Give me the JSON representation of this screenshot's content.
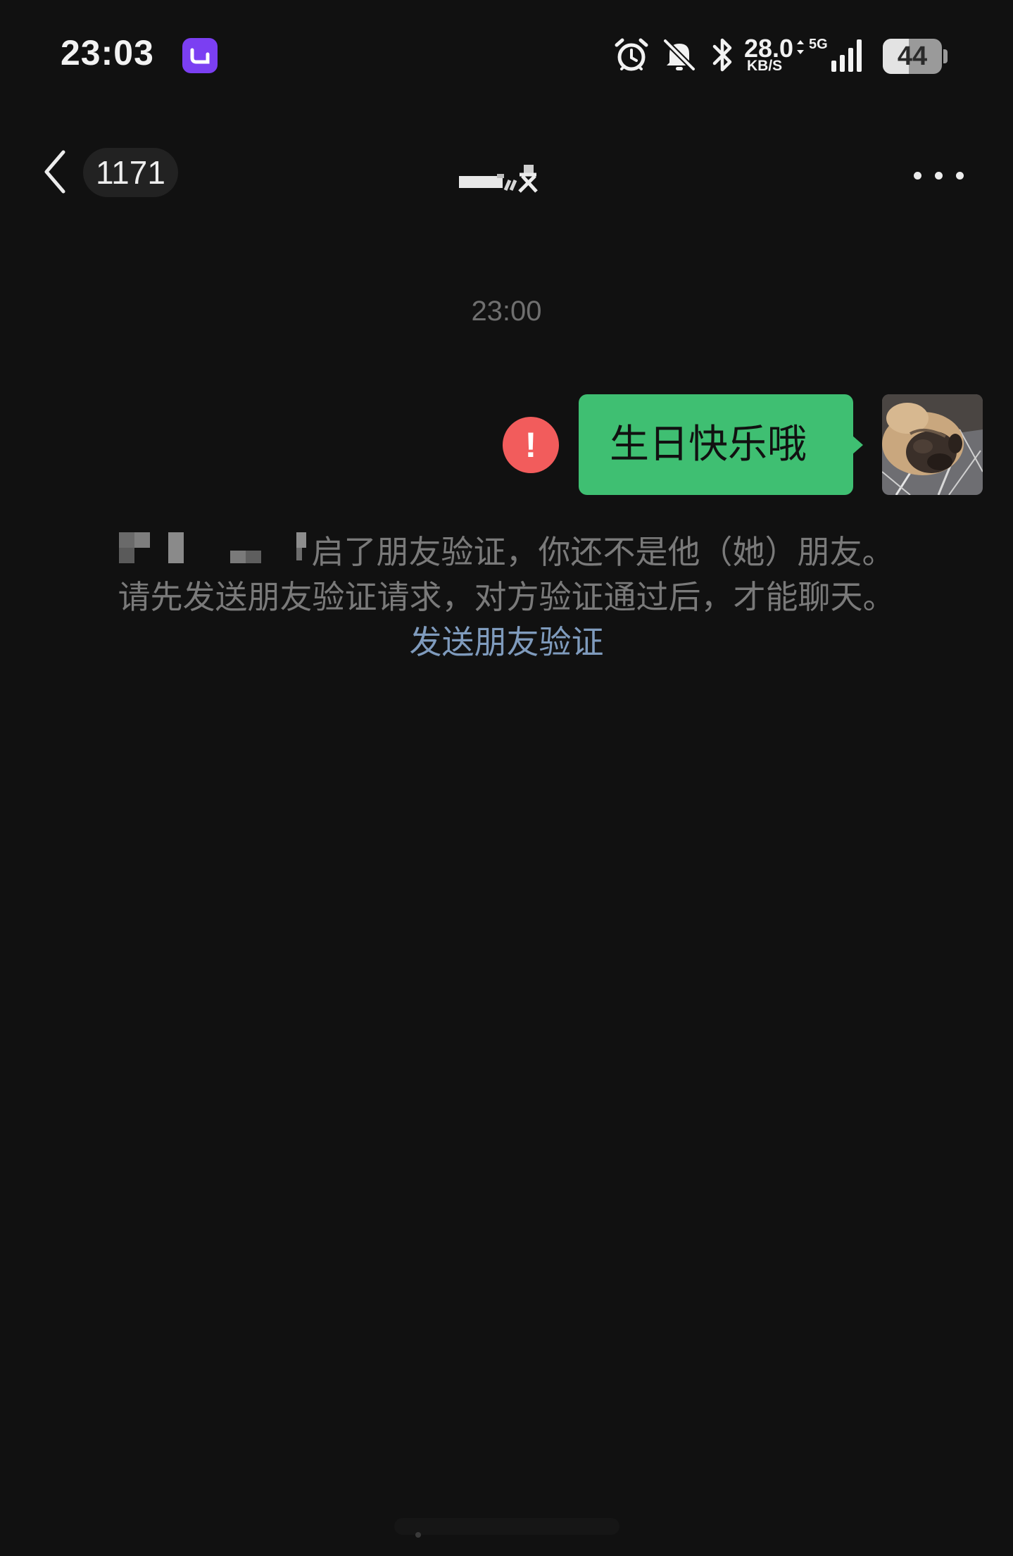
{
  "status_bar": {
    "time": "23:03",
    "net_speed_value": "28.0",
    "net_speed_unit": "KB/S",
    "network_type": "5G",
    "battery_level": "44",
    "battery_fraction": 0.44,
    "icons": [
      "app-notification-icon",
      "alarm-icon",
      "mute-icon",
      "bluetooth-icon",
      "signal-icon",
      "battery-icon"
    ]
  },
  "nav": {
    "unread_count": "1171",
    "icons": [
      "back-icon",
      "more-icon"
    ]
  },
  "chat": {
    "timestamp": "23:00",
    "messages": [
      {
        "text": "生日快乐哦",
        "status": "failed",
        "outgoing": true
      }
    ],
    "notice": {
      "line1": "启了朋友验证，你还不是他（她）朋友。",
      "line2": "请先发送朋友验证请求，对方验证通过后，才能聊天。",
      "link": "发送朋友验证"
    }
  },
  "colors": {
    "background": "#111111",
    "bubble": "#3fbf72",
    "error": "#f25c5c",
    "link": "#7f9bbd",
    "muted_text": "#7a7a7a"
  }
}
